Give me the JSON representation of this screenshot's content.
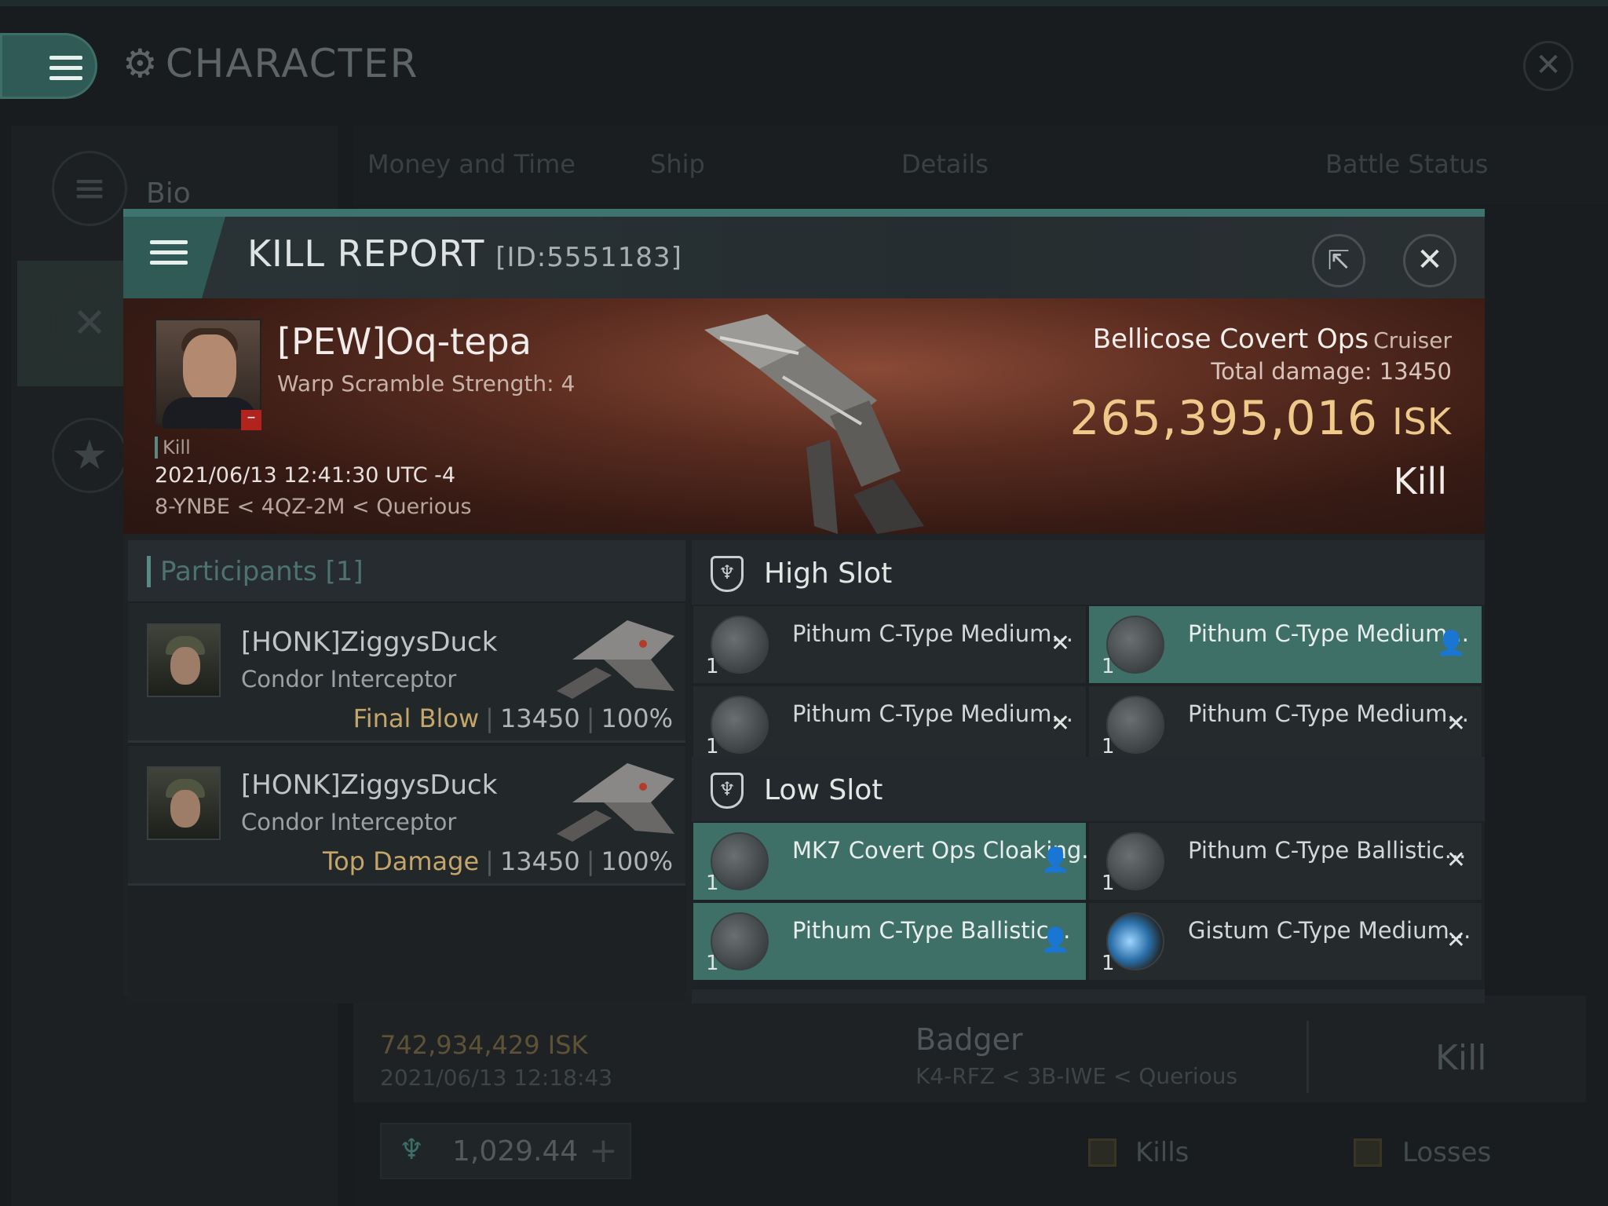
{
  "background": {
    "title": "CHARACTER",
    "sidebar_bio": "Bio",
    "tabs": [
      "Money and Time",
      "Ship",
      "Details",
      "Battle Status"
    ],
    "row": {
      "isk": "742,934,429  ISK",
      "date": "2021/06/13  12:18:43",
      "ship": "Badger",
      "location": "K4-RFZ < 3B-IWE < Querious",
      "result": "Kill"
    },
    "wallet": "1,029.44",
    "filters": {
      "kills": "Kills",
      "losses": "Losses"
    }
  },
  "modal": {
    "title": "KILL REPORT",
    "id": "[ID:5551183]",
    "victim": {
      "name": "[PEW]Oq-tepa",
      "warp": "Warp Scramble Strength: 4",
      "kill_label": "Kill",
      "date": "2021/06/13 12:41:30 UTC -4",
      "location": "8-YNBE < 4QZ-2M < Querious"
    },
    "ship": {
      "name": "Bellicose Covert Ops",
      "class": "Cruiser",
      "damage_label": "Total damage:",
      "damage_value": "13450",
      "isk_value": "265,395,016",
      "isk_unit": "ISK",
      "result": "Kill"
    },
    "participants": {
      "header": "Participants [1]",
      "rows": [
        {
          "name": "[HONK]ZiggysDuck",
          "ship": "Condor Interceptor",
          "role": "Final Blow",
          "damage": "13450",
          "percent": "100%"
        },
        {
          "name": "[HONK]ZiggysDuck",
          "ship": "Condor Interceptor",
          "role": "Top Damage",
          "damage": "13450",
          "percent": "100%"
        }
      ]
    },
    "high_slot": {
      "title": "High Slot",
      "modules": [
        {
          "name": "Pithum C-Type Medium...",
          "qty": "1",
          "status": "✕"
        },
        {
          "name": "Pithum C-Type Medium...",
          "qty": "1",
          "status": "👤"
        },
        {
          "name": "Pithum C-Type Medium...",
          "qty": "1",
          "status": "✕"
        },
        {
          "name": "Pithum C-Type Medium...",
          "qty": "1",
          "status": "✕"
        }
      ]
    },
    "low_slot": {
      "title": "Low Slot",
      "modules": [
        {
          "name": "MK7 Covert Ops Cloaking...",
          "qty": "1",
          "status": "👤"
        },
        {
          "name": "Pithum C-Type Ballistic...",
          "qty": "1",
          "status": "✕"
        },
        {
          "name": "Pithum C-Type Ballistic...",
          "qty": "1",
          "status": "👤"
        },
        {
          "name": "Gistum C-Type Medium...",
          "qty": "1",
          "status": "✕"
        }
      ]
    }
  }
}
